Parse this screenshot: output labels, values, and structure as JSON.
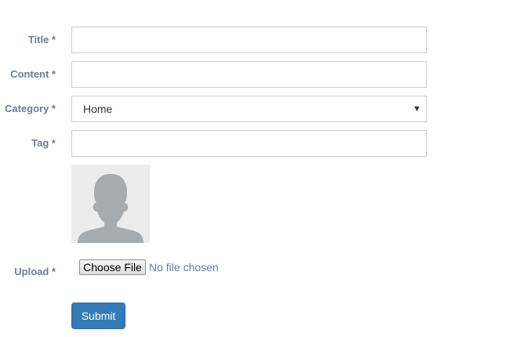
{
  "form": {
    "title": {
      "label": "Title *",
      "value": ""
    },
    "content": {
      "label": "Content *",
      "value": ""
    },
    "category": {
      "label": "Category *",
      "selected": "Home"
    },
    "tag": {
      "label": "Tag *",
      "value": ""
    },
    "upload": {
      "label": "Upload *",
      "button_label": "Choose File",
      "status": "No file chosen",
      "preview_icon": "person-silhouette-icon"
    },
    "submit_label": "Submit"
  },
  "colors": {
    "label": "#6d7c92",
    "field_border": "#cccccc",
    "avatar_background": "#ececec",
    "avatar_figure": "#a8abae",
    "submit_background": "#337ab7",
    "submit_border": "#2e6da4"
  }
}
